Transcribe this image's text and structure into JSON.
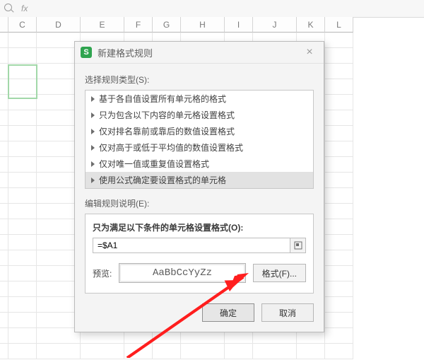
{
  "formula_bar": {
    "fx_label": "fx"
  },
  "columns": [
    "C",
    "D",
    "E",
    "F",
    "G",
    "H",
    "I",
    "J",
    "K",
    "L"
  ],
  "dialog": {
    "title": "新建格式规则",
    "select_type_label": "选择规则类型(S):",
    "rule_types": [
      "基于各自值设置所有单元格的格式",
      "只为包含以下内容的单元格设置格式",
      "仅对排名靠前或靠后的数值设置格式",
      "仅对高于或低于平均值的数值设置格式",
      "仅对唯一值或重复值设置格式",
      "使用公式确定要设置格式的单元格"
    ],
    "selected_rule_index": 5,
    "edit_desc_label": "编辑规则说明(E):",
    "condition_label": "只为满足以下条件的单元格设置格式(O):",
    "formula_value": "=$A1",
    "preview_label": "预览:",
    "preview_sample": "AaBbCcYyZz",
    "format_button": "格式(F)...",
    "ok_button": "确定",
    "cancel_button": "取消"
  }
}
